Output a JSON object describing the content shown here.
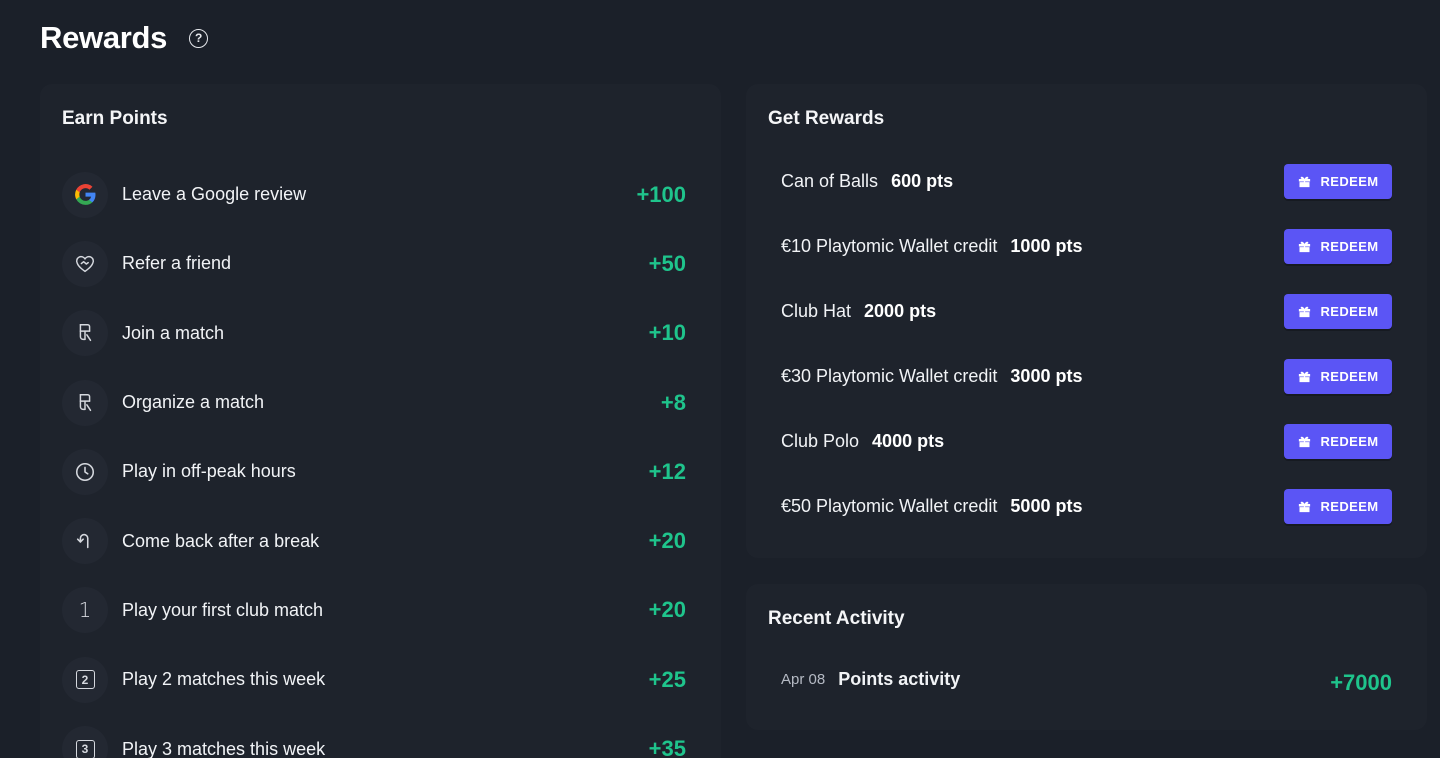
{
  "header": {
    "title": "Rewards",
    "help_icon": "?"
  },
  "earn": {
    "title": "Earn Points",
    "items": [
      {
        "icon": "google-icon",
        "label": "Leave a Google review",
        "points": "+100"
      },
      {
        "icon": "heart-handshake-icon",
        "label": "Refer a friend",
        "points": "+50"
      },
      {
        "icon": "court-icon",
        "label": "Join a match",
        "points": "+10"
      },
      {
        "icon": "court-icon",
        "label": "Organize a match",
        "points": "+8"
      },
      {
        "icon": "clock-icon",
        "label": "Play in off-peak hours",
        "points": "+12"
      },
      {
        "icon": "return-arrow-icon",
        "label": "Come back after a break",
        "points": "+20"
      },
      {
        "icon": "number-one-icon",
        "label": "Play your first club match",
        "points": "+20",
        "glyph": "1"
      },
      {
        "icon": "square-two-icon",
        "label": "Play 2 matches this week",
        "points": "+25",
        "glyph": "2"
      },
      {
        "icon": "square-three-icon",
        "label": "Play 3 matches this week",
        "points": "+35",
        "glyph": "3"
      }
    ]
  },
  "rewards": {
    "title": "Get Rewards",
    "redeem_label": "REDEEM",
    "items": [
      {
        "name": "Can of Balls",
        "pts": "600 pts"
      },
      {
        "name": "€10 Playtomic Wallet credit",
        "pts": "1000 pts"
      },
      {
        "name": "Club Hat",
        "pts": "2000 pts"
      },
      {
        "name": "€30 Playtomic Wallet credit",
        "pts": "3000 pts"
      },
      {
        "name": "Club Polo",
        "pts": "4000 pts"
      },
      {
        "name": "€50 Playtomic Wallet credit",
        "pts": "5000 pts"
      }
    ]
  },
  "activity": {
    "title": "Recent Activity",
    "items": [
      {
        "date": "Apr 08",
        "label": "Points activity",
        "points": "+7000"
      }
    ]
  },
  "colors": {
    "background": "#1b2029",
    "card": "#1e232c",
    "accent_green": "#1fc48c",
    "button": "#5b55f5"
  }
}
